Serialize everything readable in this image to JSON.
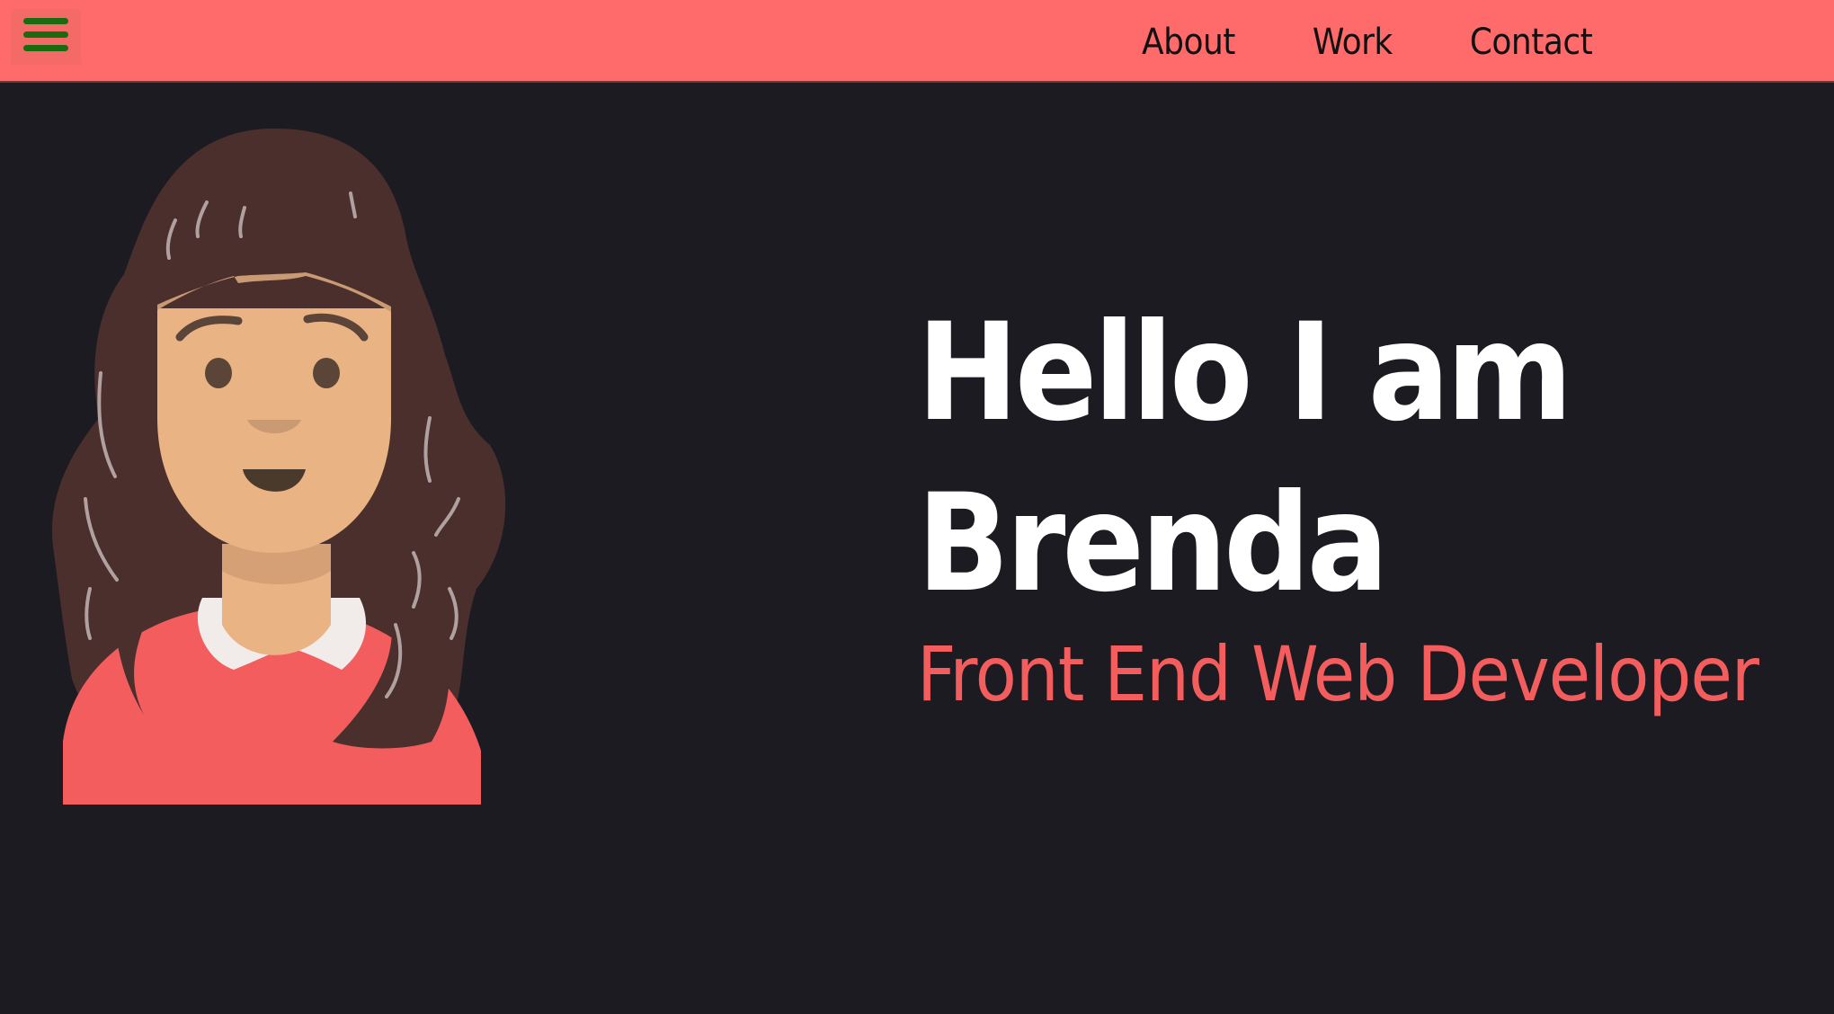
{
  "navbar": {
    "menu_icon": "hamburger-menu-icon",
    "links": [
      {
        "label": "About"
      },
      {
        "label": "Work"
      },
      {
        "label": "Contact"
      }
    ]
  },
  "hero": {
    "title_line1": "Hello I am",
    "title_line2": "Brenda",
    "subtitle": "Front End Web Developer"
  },
  "avatar": {
    "icon": "avatar-illustration"
  },
  "colors": {
    "navbar_bg": "#ff6b6b",
    "page_bg": "#1c1b21",
    "accent": "#f45d5d",
    "menu_icon": "#1a6a10",
    "title_text": "#ffffff"
  }
}
